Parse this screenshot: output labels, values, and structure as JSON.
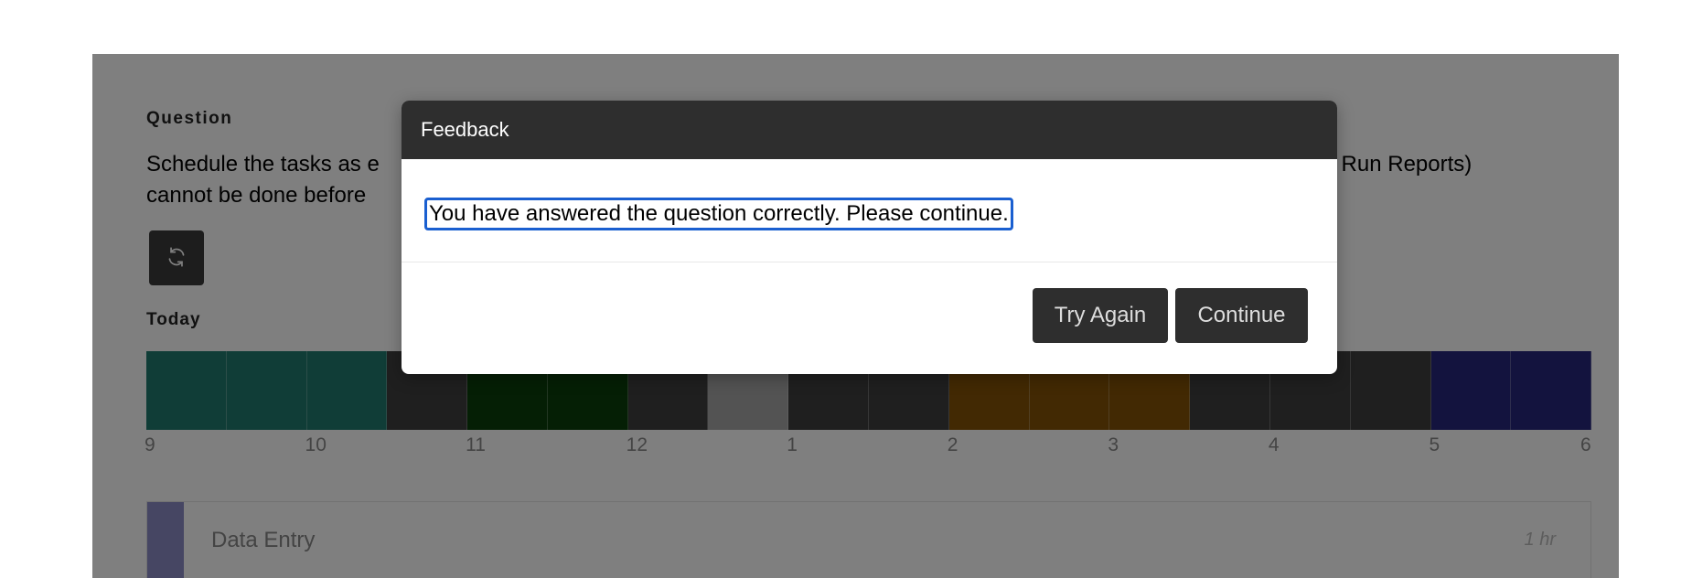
{
  "question": {
    "label": "Question",
    "text": "Schedule the tasks as e                                                                                                              and Run Reports) cannot be done before"
  },
  "reset_icon": "refresh-icon",
  "today_label": "Today",
  "timeline": {
    "slots": [
      "#217a6f",
      "#217a6f",
      "#217a6f",
      "#3f3f3f",
      "#0a3f0a",
      "#0a3f0a",
      "#3f3f3f",
      "#a6a6a6",
      "#3f3f3f",
      "#3f3f3f",
      "#845307",
      "#845307",
      "#845307",
      "#3f3f3f",
      "#3f3f3f",
      "#3f3f3f",
      "#26267c",
      "#26267c"
    ],
    "ticks": [
      "9",
      "10",
      "11",
      "12",
      "1",
      "2",
      "3",
      "4",
      "5",
      "6"
    ]
  },
  "task": {
    "name": "Data Entry",
    "duration": "1 hr",
    "color": "#8c8cc6"
  },
  "modal": {
    "title": "Feedback",
    "message": "You have answered the question correctly. Please continue.",
    "try_again_label": "Try Again",
    "continue_label": "Continue"
  }
}
